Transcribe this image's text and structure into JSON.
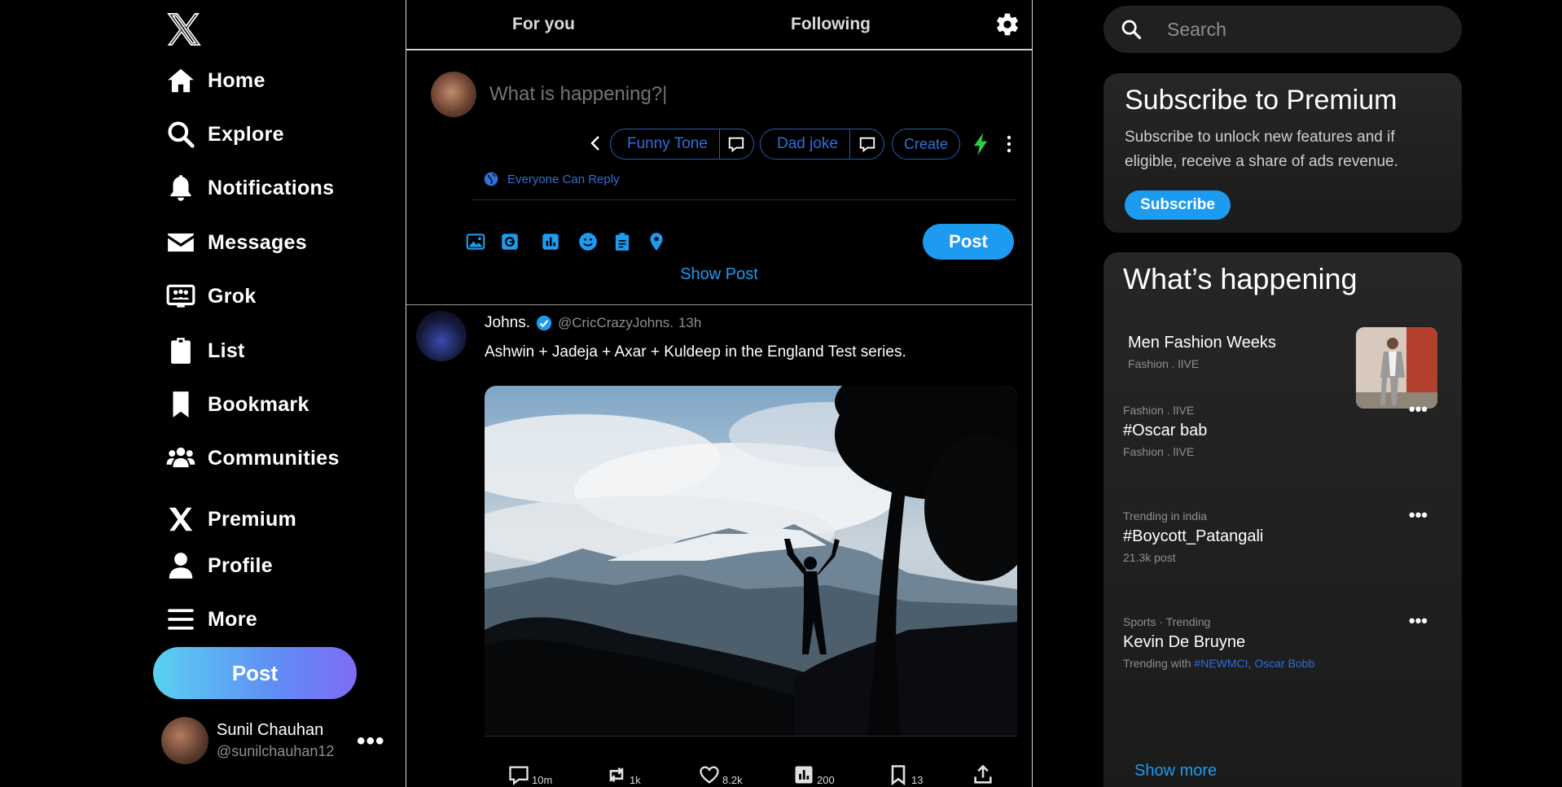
{
  "nav": {
    "home": "Home",
    "explore": "Explore",
    "notifications": "Notifications",
    "messages": "Messages",
    "grok": "Grok",
    "list": "List",
    "bookmark": "Bookmark",
    "communities": "Communities",
    "premium": "Premium",
    "profile": "Profile",
    "more": "More",
    "post_button": "Post"
  },
  "account": {
    "name": "Sunil Chauhan",
    "handle": "@sunilchauhan12",
    "more": "•••"
  },
  "tabs": {
    "for_you": "For you",
    "following": "Following"
  },
  "composer": {
    "placeholder": "What is happening?|",
    "chips": {
      "funny_tone": "Funny Tone",
      "dad_joke": "Dad joke",
      "create": "Create"
    },
    "reply_setting": "Everyone Can Reply",
    "post_button": "Post",
    "show_post": "Show Post"
  },
  "tweet": {
    "name": "Johns.",
    "handle": "@CricCrazyJohns.",
    "time": "13h",
    "text": "Ashwin + Jadeja + Axar + Kuldeep in the England Test series.",
    "stats": {
      "replies": "10m",
      "reposts": "1k",
      "likes": "8.2k",
      "views": "200",
      "bookmarks": "13"
    }
  },
  "search": {
    "placeholder": "Search"
  },
  "premium": {
    "title": "Subscribe to Premium",
    "text": "Subscribe to unlock new features and if eligible, receive a share of ads revenue.",
    "button": "Subscribe"
  },
  "trends": {
    "title": "What’s happening",
    "items": [
      {
        "name": "Men Fashion Weeks",
        "meta": "Fashion . lIVE"
      },
      {
        "meta_top": "Fashion . lIVE",
        "name": "#Oscar bab",
        "meta": "Fashion . lIVE"
      },
      {
        "meta_top": "Trending in india",
        "name": "#Boycott_Patangali",
        "meta": "21.3k post"
      },
      {
        "meta_top": "Sports · Trending",
        "name": "Kevin De Bruyne",
        "meta_prefix": "Trending with ",
        "link1": "#NEWMCI",
        "sep": ", ",
        "link2": "Oscar Bobb"
      }
    ],
    "more": "•••",
    "show_more": "Show more"
  },
  "colors": {
    "accent": "#1d9bf0",
    "chip": "#2f6fd6",
    "bolt": "#2ecc40"
  }
}
